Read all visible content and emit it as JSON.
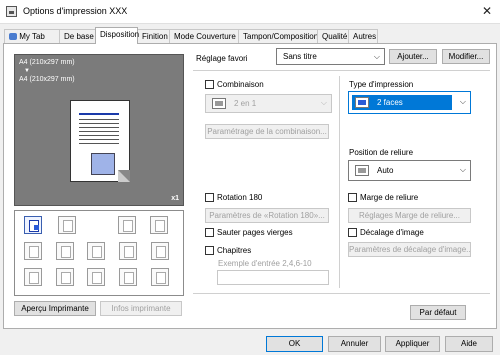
{
  "window": {
    "title": "Options d'impression XXX",
    "close_glyph": "✕"
  },
  "tabs": [
    "My Tab",
    "De base",
    "Disposition",
    "Finition",
    "Mode Couverture",
    "Tampon/Composition",
    "Qualité",
    "Autres"
  ],
  "active_tab": "Disposition",
  "preview": {
    "paper_top": "A4 (210x297 mm)",
    "arrow": "▼",
    "paper_bottom": "A4 (210x297 mm)",
    "copies": "x1"
  },
  "left_buttons": {
    "apercu": "Aperçu Imprimante",
    "infos": "Infos imprimante"
  },
  "favorites": {
    "label": "Réglage favori",
    "value": "Sans titre",
    "add": "Ajouter...",
    "modify": "Modifier..."
  },
  "combinaison": {
    "label": "Combinaison",
    "value": "2 en 1",
    "settings_button": "Paramétrage de la combinaison..."
  },
  "rotation": {
    "label": "Rotation 180",
    "settings_button": "Paramètres de «Rotation 180»..."
  },
  "skip_blank": {
    "label": "Sauter pages vierges"
  },
  "chapters": {
    "label": "Chapitres",
    "example": "Exemple d'entrée 2,4,6-10",
    "value": ""
  },
  "print_type": {
    "label": "Type d'impression",
    "value": "2 faces"
  },
  "binding": {
    "label": "Position de reliure",
    "value": "Auto"
  },
  "binding_margin": {
    "label": "Marge de reliure",
    "settings_button": "Réglages Marge de reliure..."
  },
  "image_shift": {
    "label": "Décalage d'image",
    "settings_button": "Paramètres de décalage d'image..."
  },
  "default_button": "Par défaut",
  "footer": {
    "ok": "OK",
    "cancel": "Annuler",
    "apply": "Appliquer",
    "help": "Aide"
  },
  "icons": [
    "layout-combine-icon",
    "poster-icon",
    "booklet-icon",
    "page-rotate-icon",
    "duplex-icon",
    "binding-icon",
    "margin-icon",
    "overlay-icon",
    "watermark-icon",
    "header-footer-icon",
    "copy-protect-icon",
    "stamp-icon",
    "blank-page-icon",
    "chapter-icon",
    "image-shift-icon"
  ]
}
